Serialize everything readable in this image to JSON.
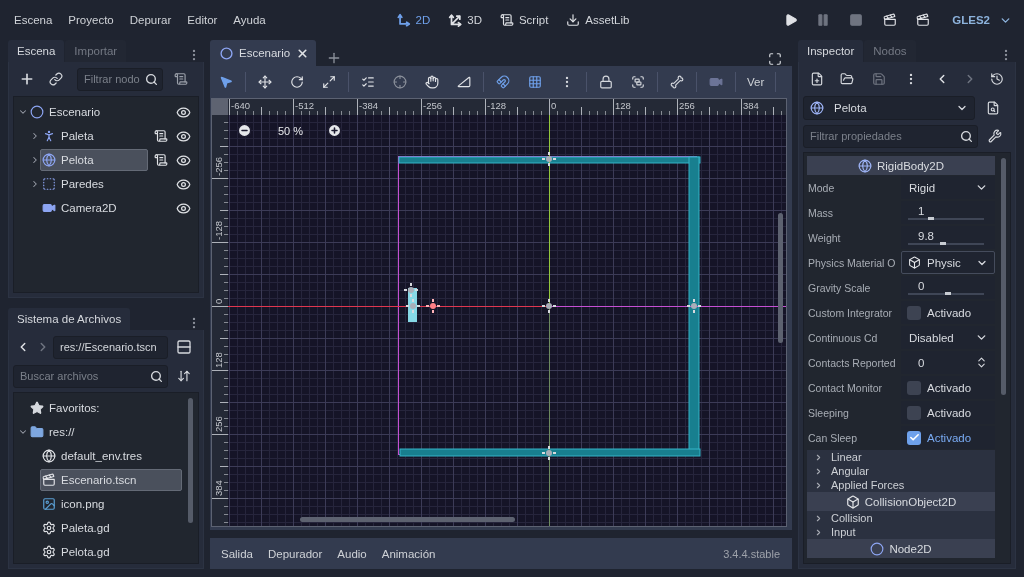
{
  "menu_bar": {
    "menus": [
      "Escena",
      "Proyecto",
      "Depurar",
      "Editor",
      "Ayuda"
    ],
    "workspaces": [
      {
        "label": "2D",
        "selected": true
      },
      {
        "label": "3D",
        "selected": false
      },
      {
        "label": "Script",
        "selected": false
      },
      {
        "label": "AssetLib",
        "selected": false
      }
    ],
    "run_controls": [
      {
        "disabled": false
      },
      {
        "disabled": true
      },
      {
        "disabled": true
      },
      {
        "disabled": false
      },
      {
        "disabled": false
      }
    ],
    "renderer": "GLES2"
  },
  "scene_dock": {
    "tabs": [
      {
        "label": "Escena",
        "selected": true
      },
      {
        "label": "Importar",
        "selected": false
      }
    ],
    "filter": {
      "placeholder": "Filtrar nodo"
    },
    "tree": [
      {
        "name": "Escenario",
        "kind": "ring",
        "expanded": true,
        "selected": false,
        "script": false,
        "visible": true,
        "children": [
          {
            "name": "Paleta",
            "kind": "figure",
            "expanded": false,
            "selected": false,
            "script": true,
            "visible": true
          },
          {
            "name": "Pelota",
            "kind": "globe",
            "expanded": false,
            "selected": true,
            "script": true,
            "visible": true
          },
          {
            "name": "Paredes",
            "kind": "frame",
            "expanded": false,
            "selected": false,
            "script": false,
            "visible": true
          },
          {
            "name": "Camera2D",
            "kind": "camera",
            "selected": false,
            "script": false,
            "visible": true
          }
        ]
      }
    ]
  },
  "filesystem_dock": {
    "tabs": [
      {
        "label": "Sistema de Archivos",
        "selected": true
      }
    ],
    "back": {
      "disabled": false
    },
    "forward": {
      "disabled": true
    },
    "path": "res://Escenario.tscn",
    "search": {
      "placeholder": "Buscar archivos"
    },
    "tree": [
      {
        "name": "Favoritos:",
        "kind": "star",
        "selected": false
      },
      {
        "name": "res://",
        "kind": "folder",
        "expanded": true,
        "selected": false,
        "children": [
          {
            "name": "default_env.tres",
            "kind": "globe",
            "selected": false
          },
          {
            "name": "Escenario.tscn",
            "kind": "clapper",
            "selected": true
          },
          {
            "name": "icon.png",
            "kind": "image",
            "selected": false
          },
          {
            "name": "Paleta.gd",
            "kind": "gear",
            "selected": false
          },
          {
            "name": "Pelota.gd",
            "kind": "gear",
            "selected": false
          }
        ]
      }
    ]
  },
  "editor": {
    "scene_tabs": [
      {
        "label": "Escenario",
        "selected": true
      }
    ],
    "tools": [
      {
        "selected": true
      },
      {
        "selected": false
      },
      {
        "selected": false
      },
      {
        "selected": false
      },
      {
        "selected": false
      },
      {
        "selected": false
      },
      {
        "selected": false
      },
      {
        "selected": false
      }
    ],
    "snapping": [
      {
        "on": true
      },
      {
        "on": true
      }
    ],
    "view_menu": "Ver",
    "zoom": "50 %",
    "top_ruler": [
      "-640",
      "-512",
      "-384",
      "-256",
      "-128",
      "0",
      "128",
      "256",
      "384"
    ],
    "left_ruler": [
      "-256",
      "-128",
      "0",
      "128",
      "256",
      "384"
    ]
  },
  "bottom_panel": {
    "tabs": [
      {
        "label": "Salida",
        "selected": false
      },
      {
        "label": "Depurador",
        "selected": false
      },
      {
        "label": "Audio",
        "selected": false
      },
      {
        "label": "Animación",
        "selected": false
      }
    ],
    "version": "3.4.4.stable"
  },
  "inspector": {
    "tabs": [
      {
        "label": "Inspector",
        "selected": true
      },
      {
        "label": "Nodos",
        "selected": false
      }
    ],
    "save": {
      "disabled": true
    },
    "back": {
      "disabled": false
    },
    "forward": {
      "disabled": true
    },
    "object": "Pelota",
    "filter": {
      "placeholder": "Filtrar propiedades"
    },
    "categories": [
      {
        "title": "RigidBody2D",
        "kind": "globe",
        "items": [
          {
            "kind": "dropdown",
            "label": "Mode",
            "value": "Rigid"
          },
          {
            "kind": "slider",
            "label": "Mass",
            "value": "1",
            "level": 0.3
          },
          {
            "kind": "slider",
            "label": "Weight",
            "value": "9.8",
            "level": 0.46
          },
          {
            "kind": "resource",
            "label": "Physics Material O",
            "value": "Physic"
          },
          {
            "kind": "slider",
            "label": "Gravity Scale",
            "value": "0",
            "level": 0.52
          },
          {
            "kind": "checkbox",
            "label": "Custom Integrator",
            "value": "Activado",
            "checked": false
          },
          {
            "kind": "dropdown",
            "label": "Continuous Cd",
            "value": "Disabled"
          },
          {
            "kind": "spin",
            "label": "Contacts Reported",
            "value": "0"
          },
          {
            "kind": "checkbox",
            "label": "Contact Monitor",
            "value": "Activado",
            "checked": false
          },
          {
            "kind": "checkbox",
            "label": "Sleeping",
            "value": "Activado",
            "checked": false
          },
          {
            "kind": "checkbox",
            "label": "Can Sleep",
            "value": "Activado",
            "checked": true
          },
          {
            "kind": "group",
            "label": "Linear",
            "expanded": false
          },
          {
            "kind": "group",
            "label": "Angular",
            "expanded": false
          },
          {
            "kind": "group",
            "label": "Applied Forces",
            "expanded": false
          }
        ]
      },
      {
        "title": "CollisionObject2D",
        "kind": "cube",
        "items": [
          {
            "kind": "group",
            "label": "Collision",
            "expanded": false
          },
          {
            "kind": "group",
            "label": "Input",
            "expanded": false
          }
        ]
      },
      {
        "title": "Node2D",
        "kind": "ring"
      }
    ]
  }
}
